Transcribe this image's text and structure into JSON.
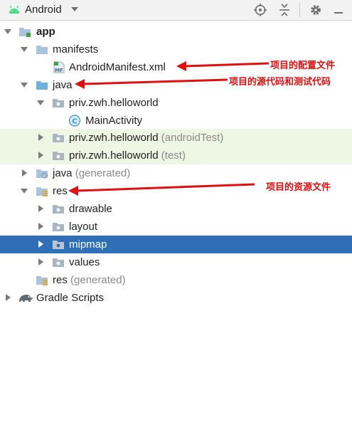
{
  "toolbar": {
    "view_title": "Android",
    "buttons": [
      "locate-icon",
      "collapse-all-icon",
      "settings-icon",
      "hide-icon"
    ]
  },
  "tree": {
    "app": "app",
    "manifests": "manifests",
    "android_manifest": "AndroidManifest.xml",
    "java": "java",
    "pkg_main": "priv.zwh.helloworld",
    "main_activity": "MainActivity",
    "pkg_android_test": "priv.zwh.helloworld",
    "pkg_android_test_suffix": "(androidTest)",
    "pkg_test": "priv.zwh.helloworld",
    "pkg_test_suffix": "(test)",
    "java_generated": "java",
    "java_generated_suffix": "(generated)",
    "res": "res",
    "drawable": "drawable",
    "layout": "layout",
    "mipmap": "mipmap",
    "values": "values",
    "res_generated": "res",
    "res_generated_suffix": "(generated)",
    "gradle_scripts": "Gradle Scripts",
    "manifest_badge": "MF",
    "class_badge": "C"
  },
  "annotations": {
    "manifest_note": "项目的配置文件",
    "java_note": "项目的源代码和测试代码",
    "res_note": "项目的资源文件"
  },
  "colors": {
    "selected_row": "#2f6fb7",
    "test_row": "#eef6e4",
    "annotation": "#e01010",
    "folder": "#a9c4dc",
    "java_folder": "#6fb2e0"
  }
}
